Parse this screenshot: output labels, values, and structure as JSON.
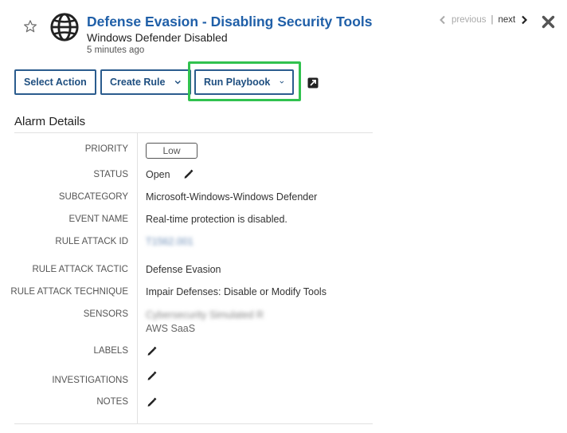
{
  "header": {
    "title": "Defense Evasion - Disabling Security Tools",
    "subtitle": "Windows Defender Disabled",
    "timestamp": "5 minutes ago",
    "icon": "globe-icon",
    "favorite_icon": "star-outline-icon"
  },
  "pager": {
    "previous_label": "previous",
    "separator": "|",
    "next_label": "next"
  },
  "toolbar": {
    "select_action_label": "Select Action",
    "create_rule_label": "Create Rule",
    "run_playbook_label": "Run Playbook"
  },
  "section": {
    "title": "Alarm Details"
  },
  "details": {
    "priority_label": "PRIORITY",
    "priority_value": "Low",
    "status_label": "STATUS",
    "status_value": "Open",
    "subcategory_label": "SUBCATEGORY",
    "subcategory_value": "Microsoft-Windows-Windows Defender",
    "event_name_label": "EVENT NAME",
    "event_name_value": "Real-time protection is disabled.",
    "rule_attack_id_label": "RULE ATTACK ID",
    "rule_attack_id_value": "T1562.001",
    "rule_attack_tactic_label": "RULE ATTACK TACTIC",
    "rule_attack_tactic_value": "Defense Evasion",
    "rule_attack_technique_label": "RULE ATTACK TECHNIQUE",
    "rule_attack_technique_value": "Impair Defenses: Disable or Modify Tools",
    "sensors_label": "SENSORS",
    "sensors_value_1": "Cybersecurity Simulated R",
    "sensors_value_2": "AWS SaaS",
    "labels_label": "LABELS",
    "investigations_label": "INVESTIGATIONS",
    "notes_label": "NOTES"
  },
  "colors": {
    "brand_blue": "#1f5fa8",
    "button_border": "#2b5c8e",
    "highlight_green": "#31c24f"
  }
}
